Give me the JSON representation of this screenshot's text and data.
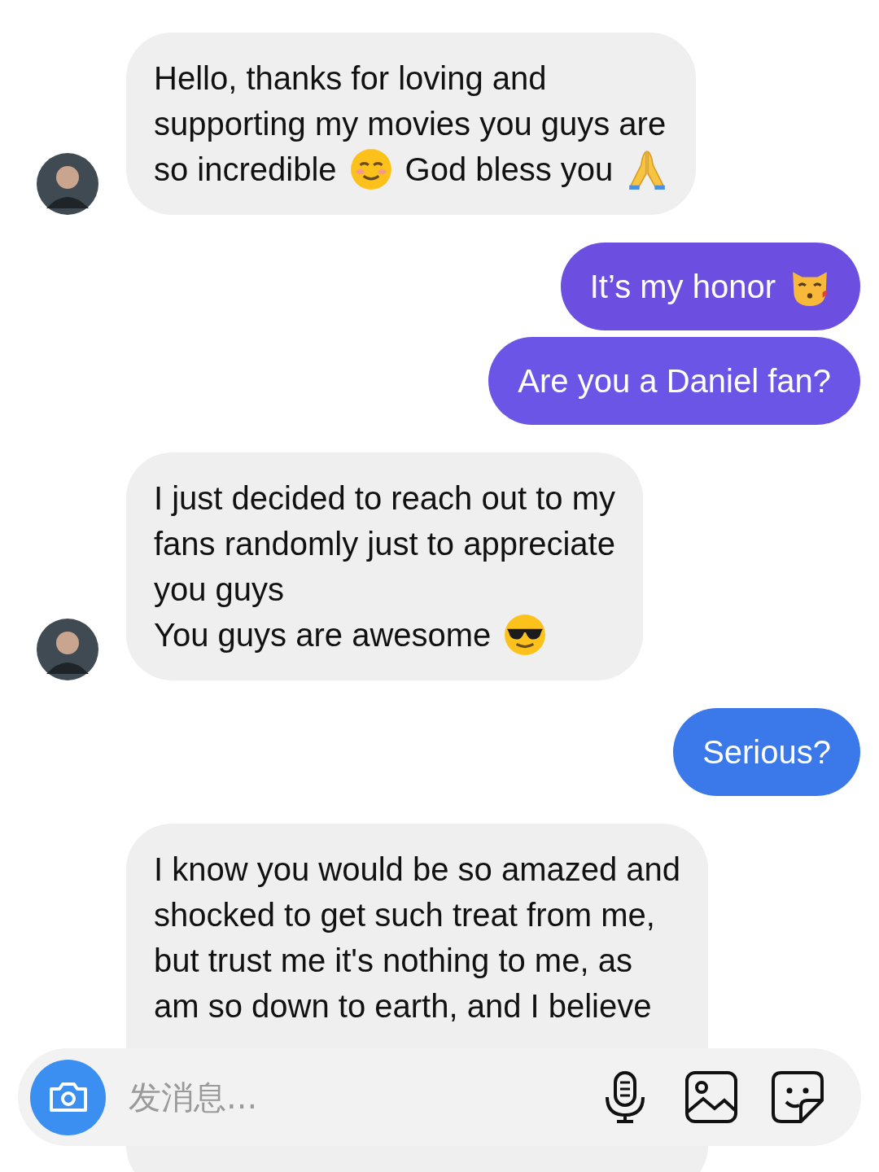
{
  "messages": [
    {
      "kind": "received",
      "lines": [
        [
          {
            "kind": "text",
            "text": "Hello, thanks for loving and"
          }
        ],
        [
          {
            "kind": "text",
            "text": "supporting my movies you guys are"
          }
        ],
        [
          {
            "kind": "text",
            "text": "so incredible"
          },
          {
            "kind": "smile"
          },
          {
            "kind": "text",
            "text": "God bless you"
          },
          {
            "kind": "pray"
          }
        ]
      ]
    },
    {
      "kind": "sent",
      "color": "#6c4fe0",
      "lines": [
        [
          {
            "kind": "text",
            "text": "It’s my honor"
          },
          {
            "kind": "kiss"
          }
        ]
      ]
    },
    {
      "kind": "sent",
      "color": "#6a55e6",
      "lines": [
        [
          {
            "kind": "text",
            "text": "Are you a Daniel fan?"
          }
        ]
      ]
    },
    {
      "kind": "received",
      "lines": [
        [
          {
            "kind": "text",
            "text": "I just decided to reach out to my"
          }
        ],
        [
          {
            "kind": "text",
            "text": "fans randomly just to appreciate"
          }
        ],
        [
          {
            "kind": "text",
            "text": "you guys"
          }
        ],
        [
          {
            "kind": "text",
            "text": "You guys are awesome"
          },
          {
            "kind": "cool"
          }
        ]
      ]
    },
    {
      "kind": "sent",
      "color": "#3b78ea",
      "lines": [
        [
          {
            "kind": "text",
            "text": "Serious?"
          }
        ]
      ]
    },
    {
      "kind": "received",
      "cut": true,
      "lines": [
        [
          {
            "kind": "text",
            "text": "I know you would be so amazed and"
          }
        ],
        [
          {
            "kind": "text",
            "text": "shocked to get such treat from me,"
          }
        ],
        [
          {
            "kind": "text",
            "text": "but trust me it's nothing to me, as"
          }
        ],
        [
          {
            "kind": "text",
            "text": "am so down to earth, and I believe"
          }
        ]
      ]
    }
  ],
  "composer": {
    "placeholder": "发消息..."
  }
}
